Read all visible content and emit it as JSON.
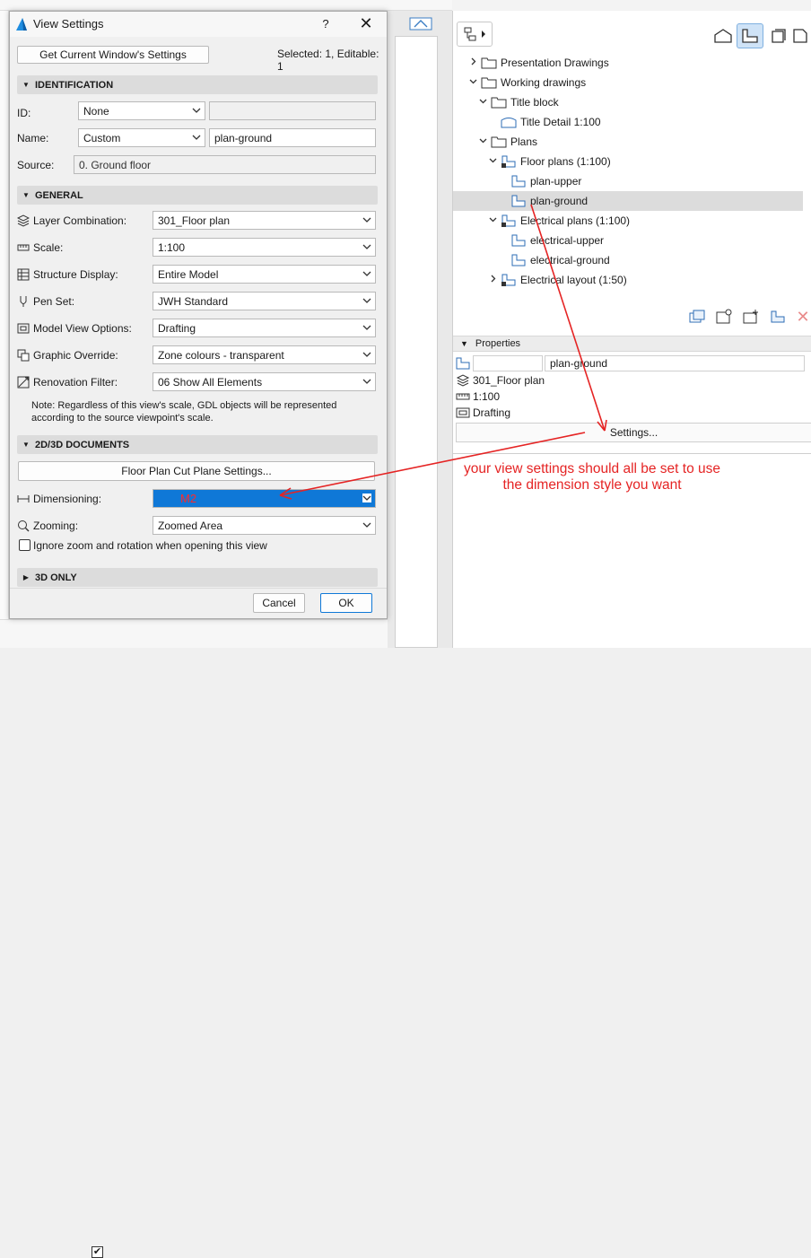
{
  "dialog": {
    "title": "View Settings",
    "help": "?",
    "close": "✕",
    "get_settings_button": "Get Current Window's Settings",
    "selected_info": "Selected: 1, Editable: 1",
    "sections": {
      "identification": "IDENTIFICATION",
      "general": "GENERAL",
      "documents": "2D/3D DOCUMENTS",
      "only3d": "3D ONLY"
    },
    "identification": {
      "id_label": "ID:",
      "id_value": "None",
      "name_label": "Name:",
      "name_value": "Custom",
      "name_text": "plan-ground",
      "source_label": "Source:",
      "source_value": "0. Ground floor"
    },
    "general": {
      "layer_label": "Layer Combination:",
      "layer_value": "301_Floor plan",
      "scale_label": "Scale:",
      "scale_value": "1:100",
      "structure_label": "Structure Display:",
      "structure_value": "Entire Model",
      "pen_label": "Pen Set:",
      "pen_value": "JWH Standard",
      "mvo_label": "Model View Options:",
      "mvo_value": "Drafting",
      "graphic_label": "Graphic Override:",
      "graphic_value": "Zone colours - transparent",
      "renovation_label": "Renovation Filter:",
      "renovation_value": "06 Show All Elements",
      "note": "Note: Regardless of this view's scale, GDL objects will be represented according to the source viewpoint's scale."
    },
    "documents": {
      "cut_plane_button": "Floor Plan Cut Plane Settings...",
      "dimensioning_label": "Dimensioning:",
      "dimensioning_value": "M2",
      "zooming_label": "Zooming:",
      "zooming_value": "Zoomed Area",
      "ignore_label": "Ignore zoom and rotation when opening this view"
    },
    "buttons": {
      "cancel": "Cancel",
      "ok": "OK"
    }
  },
  "navigator": {
    "tree": [
      {
        "label": "Presentation Drawings",
        "indent": 0,
        "twisty": "right",
        "icon": "folder-icon"
      },
      {
        "label": "Working drawings",
        "indent": 0,
        "twisty": "down",
        "icon": "folder-icon"
      },
      {
        "label": "Title block",
        "indent": 1,
        "twisty": "down",
        "icon": "folder-icon"
      },
      {
        "label": "Title Detail 1:100",
        "indent": 2,
        "twisty": "",
        "icon": "view-3d-icon"
      },
      {
        "label": "Plans",
        "indent": 1,
        "twisty": "down",
        "icon": "folder-icon"
      },
      {
        "label": "Floor plans (1:100)",
        "indent": 2,
        "twisty": "down",
        "icon": "plan-folder-icon"
      },
      {
        "label": "plan-upper",
        "indent": 3,
        "twisty": "",
        "icon": "plan-view-icon"
      },
      {
        "label": "plan-ground",
        "indent": 3,
        "twisty": "",
        "icon": "plan-view-icon",
        "selected": true
      },
      {
        "label": "Electrical plans (1:100)",
        "indent": 2,
        "twisty": "down",
        "icon": "plan-folder-icon"
      },
      {
        "label": "electrical-upper",
        "indent": 3,
        "twisty": "",
        "icon": "plan-view-icon"
      },
      {
        "label": "electrical-ground",
        "indent": 3,
        "twisty": "",
        "icon": "plan-view-icon"
      },
      {
        "label": "Electrical layout (1:50)",
        "indent": 2,
        "twisty": "right",
        "icon": "plan-folder-icon"
      }
    ],
    "properties": {
      "header": "Properties",
      "name_value": "plan-ground",
      "layer": "301_Floor plan",
      "scale": "1:100",
      "model_view": "Drafting",
      "settings_button": "Settings..."
    }
  },
  "annotation": "your view settings should all be set to use the dimension style you want",
  "colors": {
    "accent": "#0f78d7",
    "annotation": "#e52424",
    "selection": "#dcdcdc"
  }
}
